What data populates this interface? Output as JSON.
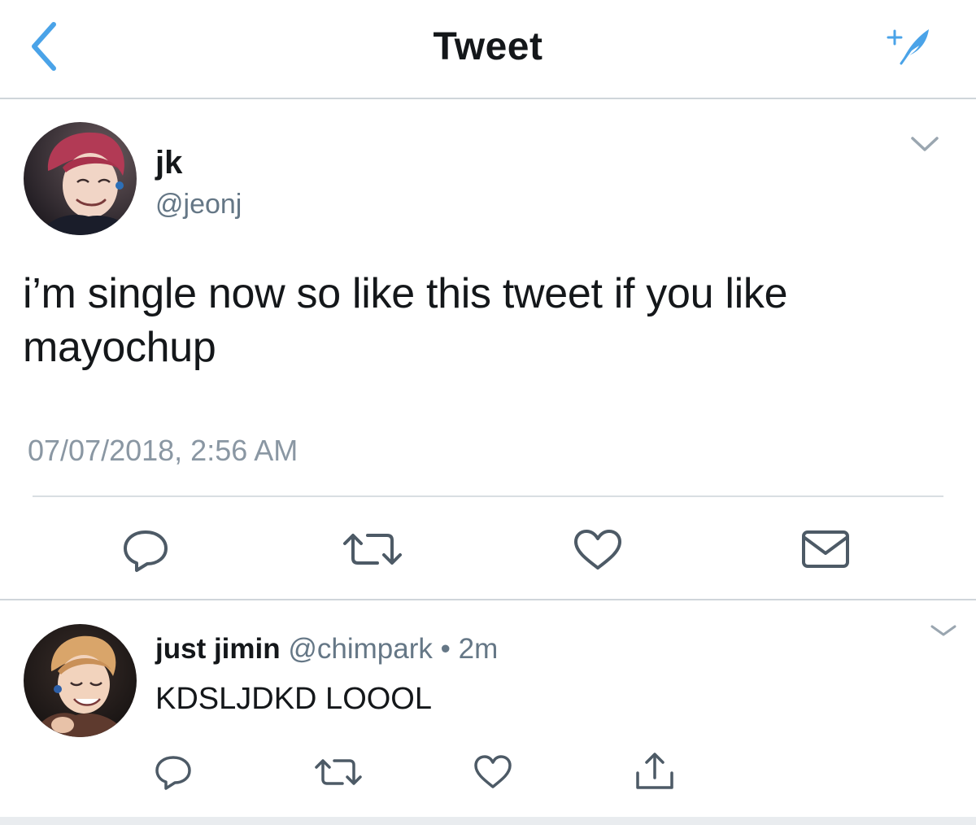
{
  "header": {
    "title": "Tweet",
    "back_icon": "chevron-left-icon",
    "compose_icon": "compose-tweet-icon",
    "accent_color": "#4aa3e8"
  },
  "tweet": {
    "display_name": "jk",
    "handle": "@jeonj",
    "text": "i’m single now so like this tweet if you like mayochup",
    "timestamp": "07/07/2018, 2:56 AM",
    "actions": [
      "reply-icon",
      "retweet-icon",
      "like-icon",
      "direct-message-icon"
    ]
  },
  "reply": {
    "display_name": "just jimin",
    "handle": "@chimpark",
    "separator": "•",
    "time_ago": "2m",
    "text": "KDSLJDKD LOOOL",
    "actions": [
      "reply-icon",
      "retweet-icon",
      "like-icon",
      "share-icon"
    ]
  },
  "colors": {
    "text_primary": "#14171a",
    "text_secondary": "#657786",
    "icon_gray": "#4d5a66",
    "divider": "#cfd5da"
  }
}
